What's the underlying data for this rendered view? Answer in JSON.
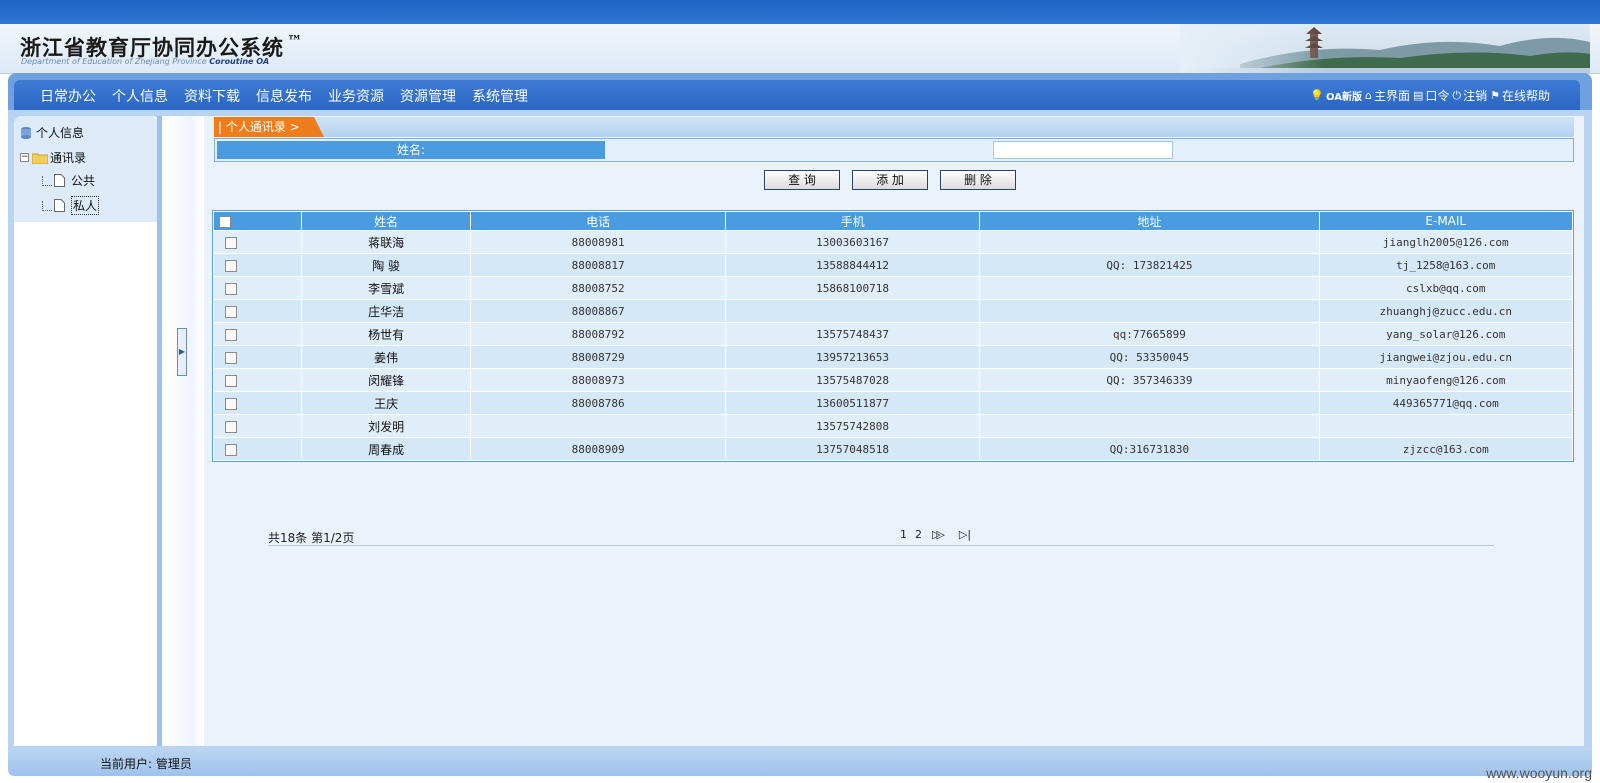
{
  "header": {
    "title": "浙江省教育厅协同办公系统",
    "tm": "™",
    "subtitle_en": "Department of Education of Zhejiang Province",
    "subtitle_brand": "Coroutine OA"
  },
  "nav": {
    "menu": [
      "日常办公",
      "个人信息",
      "资料下载",
      "信息发布",
      "业务资源",
      "资源管理",
      "系统管理"
    ],
    "tools": {
      "oa_new": "OA新版",
      "home": "主界面",
      "password": "口令",
      "logout": "注销",
      "help": "在线帮助"
    }
  },
  "sidebar": {
    "root": "个人信息",
    "folder": "通讯录",
    "leaf_public": "公共",
    "leaf_private": "私人"
  },
  "main": {
    "crumb": "| 个人通讯录 >",
    "search_label": "姓名:",
    "search_value": "",
    "buttons": {
      "query": "查 询",
      "add": "添 加",
      "delete": "删 除"
    },
    "columns": [
      "姓名",
      "电话",
      "手机",
      "地址",
      "E-MAIL"
    ],
    "rows": [
      {
        "name": "蒋联海",
        "phone": "88008981",
        "mobile": "13003603167",
        "address": "",
        "email": "jianglh2005@126.com"
      },
      {
        "name": "陶 骏",
        "phone": "88008817",
        "mobile": "13588844412",
        "address": "QQ: 173821425",
        "email": "tj_1258@163.com"
      },
      {
        "name": "李雪斌",
        "phone": "88008752",
        "mobile": "15868100718",
        "address": "",
        "email": "cslxb@qq.com"
      },
      {
        "name": "庄华洁",
        "phone": "88008867",
        "mobile": "",
        "address": "",
        "email": "zhuanghj@zucc.edu.cn"
      },
      {
        "name": "杨世有",
        "phone": "88008792",
        "mobile": "13575748437",
        "address": "qq:77665899",
        "email": "yang_solar@126.com"
      },
      {
        "name": "姜伟",
        "phone": "88008729",
        "mobile": "13957213653",
        "address": "QQ: 53350045",
        "email": "jiangwei@zjou.edu.cn"
      },
      {
        "name": "闵耀锋",
        "phone": "88008973",
        "mobile": "13575487028",
        "address": "QQ: 357346339",
        "email": "minyaofeng@126.com"
      },
      {
        "name": "王庆",
        "phone": "88008786",
        "mobile": "13600511877",
        "address": "",
        "email": "449365771@qq.com"
      },
      {
        "name": "刘发明",
        "phone": "",
        "mobile": "13575742808",
        "address": "",
        "email": ""
      },
      {
        "name": "周春成",
        "phone": "88008909",
        "mobile": "13757048518",
        "address": "QQ:316731830",
        "email": "zjzcc@163.com"
      }
    ],
    "pager": {
      "total": "共18条 第1/2页",
      "page1": "1",
      "page2": "2",
      "next": "▷▷",
      "last": "▷|"
    }
  },
  "footer": {
    "current_user": "当前用户: 管理员"
  },
  "watermark": "www.wooyun.org",
  "colors": {
    "nav_blue": "#2a66c4",
    "header_blue": "#4a9be0",
    "crumb_orange": "#f07d1b",
    "row_light": "#e0eefa"
  },
  "icons": [
    "bulb-icon",
    "home-icon",
    "key-icon",
    "power-icon",
    "flag-icon",
    "database-icon",
    "folder-icon",
    "page-icon"
  ]
}
